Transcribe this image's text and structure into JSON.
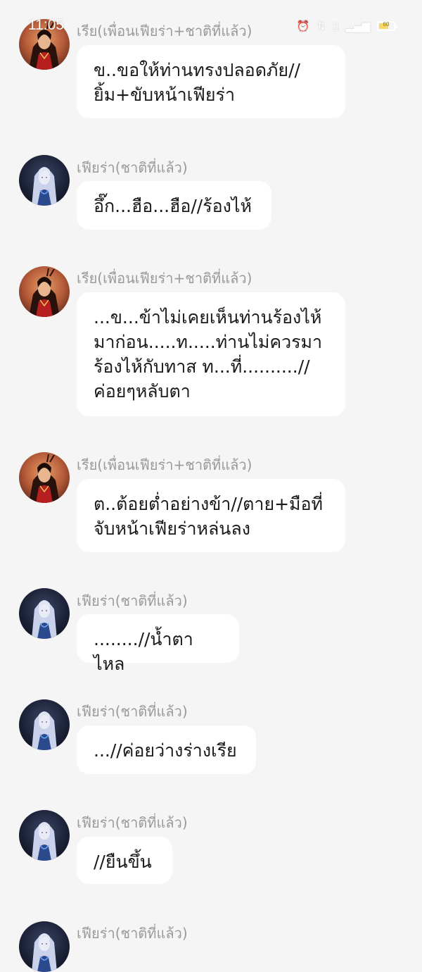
{
  "status_bar": {
    "time": "11:05",
    "battery_level": "60",
    "icons": [
      "alarm-icon",
      "data-arrows-icon",
      "sim-icon",
      "signal-icon",
      "battery-icon"
    ]
  },
  "messages": [
    {
      "sender": "เรีย(เพื่อนเฟียร่า+ชาติที่แล้ว)",
      "avatar": "ria-avatar",
      "text": "ข..ขอให้ท่านทรงปลอดภัย//\nยิ้ม+ขับหน้าเฟียร่า"
    },
    {
      "sender": "เฟียร่า(ชาติที่แล้ว)",
      "avatar": "fiara-avatar",
      "text": "อึ๊ก...ฮือ...ฮือ//ร้องไห้"
    },
    {
      "sender": "เรีย(เพื่อนเฟียร่า+ชาติที่แล้ว)",
      "avatar": "ria-avatar",
      "text": "...ข...ข้าไม่เคยเห็นท่านร้องไห้\nมาก่อน.....ท.....ท่านไม่ควรมา\nร้องไห้กับทาส ท...ที่..........//\nค่อยๆหลับตา"
    },
    {
      "sender": "เรีย(เพื่อนเฟียร่า+ชาติที่แล้ว)",
      "avatar": "ria-avatar",
      "text": "ต..ต้อยต่ำอย่างข้า//ตาย+มือที่\nจับหน้าเฟียร่าหล่นลง"
    },
    {
      "sender": "เฟียร่า(ชาติที่แล้ว)",
      "avatar": "fiara-avatar",
      "text": "........//น้ำตาไหล"
    },
    {
      "sender": "เฟียร่า(ชาติที่แล้ว)",
      "avatar": "fiara-avatar",
      "text": "...//ค่อยว่างร่างเรีย"
    },
    {
      "sender": "เฟียร่า(ชาติที่แล้ว)",
      "avatar": "fiara-avatar",
      "text": "//ยืนขึ้น"
    },
    {
      "sender": "เฟียร่า(ชาติที่แล้ว)",
      "avatar": "fiara-avatar",
      "text": ""
    }
  ]
}
